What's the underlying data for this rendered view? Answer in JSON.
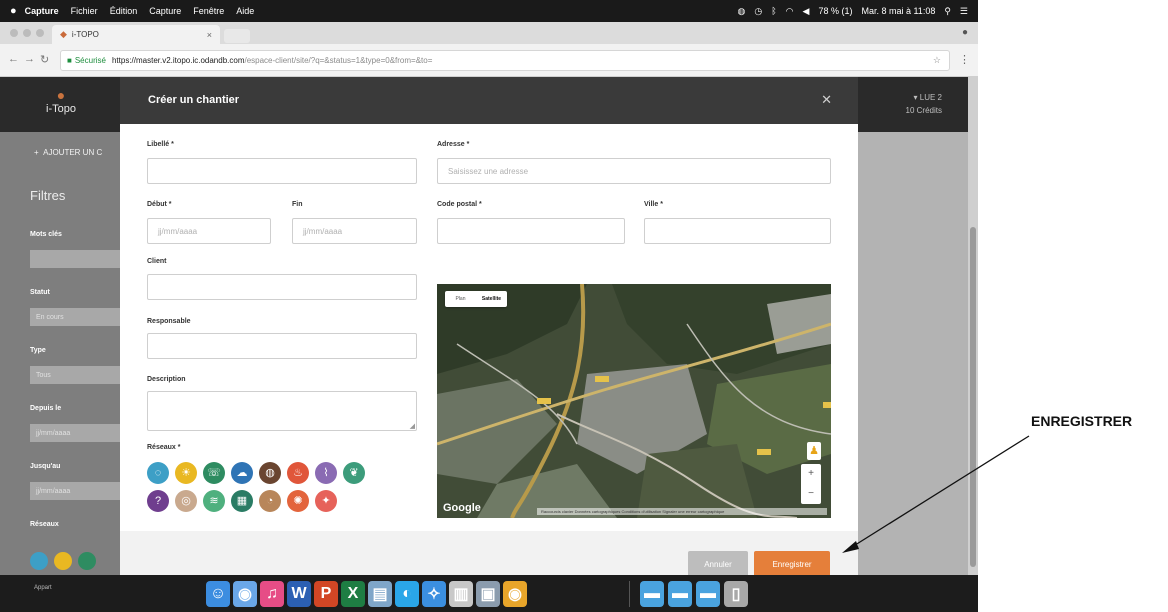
{
  "menubar": {
    "app": "Capture",
    "items": [
      "Fichier",
      "Édition",
      "Capture",
      "Fenêtre",
      "Aide"
    ],
    "battery": "78 % (1)",
    "datetime": "Mar. 8 mai à 11:08"
  },
  "browser": {
    "tab_title": "i-TOPO",
    "secure_label": "Sécurisé",
    "url_host": "https://master.v2.itopo.ic.odandb.com",
    "url_rest": "/espace-client/site/?q=&status=1&type=0&from=&to="
  },
  "app": {
    "logo_text": "i-Topo",
    "user_name": "LUE 2",
    "user_credits": "10 Crédits"
  },
  "sidebar": {
    "add_label": "AJOUTER UN C",
    "filters_title": "Filtres",
    "keywords_label": "Mots clés",
    "status_label": "Statut",
    "status_value": "En cours",
    "type_label": "Type",
    "type_value": "Tous",
    "since_label": "Depuis le",
    "since_placeholder": "jj/mm/aaaa",
    "until_label": "Jusqu'au",
    "until_placeholder": "jj/mm/aaaa",
    "networks_label": "Réseaux"
  },
  "modal": {
    "title": "Créer un chantier",
    "close_icon": "close-icon",
    "label_libelle": "Libellé *",
    "label_debut": "Début *",
    "label_fin": "Fin",
    "date_placeholder": "jj/mm/aaaa",
    "label_client": "Client",
    "label_responsable": "Responsable",
    "label_description": "Description",
    "label_reseaux": "Réseaux *",
    "label_adresse": "Adresse *",
    "adresse_placeholder": "Saisissez une adresse",
    "label_code_postal": "Code postal *",
    "label_ville": "Ville *",
    "map": {
      "toggle_plan": "Plan",
      "toggle_satellite": "Satellite",
      "google": "Google",
      "footer": "Raccourcis clavier  Données cartographiques  Conditions d'utilisation  Signaler une erreur cartographique"
    },
    "network_icons_row1": [
      {
        "icon": "water-drop-icon",
        "color": "#3d9fc6",
        "glyph": "◌"
      },
      {
        "icon": "light-bulb-icon",
        "color": "#e9b822",
        "glyph": "☀"
      },
      {
        "icon": "phone-icon",
        "color": "#2e8c61",
        "glyph": "☏"
      },
      {
        "icon": "cloud-icon",
        "color": "#2f74b5",
        "glyph": "☁"
      },
      {
        "icon": "gas-icon",
        "color": "#6a4530",
        "glyph": "◍"
      },
      {
        "icon": "flame-icon",
        "color": "#e0563a",
        "glyph": "♨"
      },
      {
        "icon": "signal-icon",
        "color": "#8a6bb3",
        "glyph": "⌇"
      },
      {
        "icon": "leaf-icon",
        "color": "#3c9c7b",
        "glyph": "❦"
      }
    ],
    "network_icons_row2": [
      {
        "icon": "question-icon",
        "color": "#6f3e8e",
        "glyph": "?"
      },
      {
        "icon": "ring-icon",
        "color": "#c9a98e",
        "glyph": "◎"
      },
      {
        "icon": "pipe-icon",
        "color": "#4fb07e",
        "glyph": "≋"
      },
      {
        "icon": "chart-icon",
        "color": "#2a7c64",
        "glyph": "▦"
      },
      {
        "icon": "gauge-icon",
        "color": "#b8865a",
        "glyph": "◔"
      },
      {
        "icon": "heat-icon",
        "color": "#e3643c",
        "glyph": "✺"
      },
      {
        "icon": "bulb-icon",
        "color": "#e6625a",
        "glyph": "✦"
      }
    ],
    "cancel_label": "Annuler",
    "save_label": "Enregistrer"
  },
  "dock": {
    "left_label": "Appart",
    "apps": [
      {
        "icon": "finder-icon",
        "color": "#3c8de0",
        "glyph": "☺"
      },
      {
        "icon": "chrome-icon",
        "color": "#6aa7e8",
        "glyph": "◉"
      },
      {
        "icon": "itunes-icon",
        "color": "#e64d86",
        "glyph": "♫"
      },
      {
        "icon": "word-icon",
        "color": "#2b5fb3",
        "glyph": "W"
      },
      {
        "icon": "powerpoint-icon",
        "color": "#d24625",
        "glyph": "P"
      },
      {
        "icon": "excel-icon",
        "color": "#1e7d43",
        "glyph": "X"
      },
      {
        "icon": "preview-icon",
        "color": "#7fa6c9",
        "glyph": "▤"
      },
      {
        "icon": "messages-icon",
        "color": "#2aa6e8",
        "glyph": "◐"
      },
      {
        "icon": "safari-icon",
        "color": "#3b8fe0",
        "glyph": "✧"
      },
      {
        "icon": "photos-icon",
        "color": "#c8c8c8",
        "glyph": "▥"
      },
      {
        "icon": "image-capture-icon",
        "color": "#8b9cae",
        "glyph": "▣"
      },
      {
        "icon": "chrome-alt-icon",
        "color": "#e8a52a",
        "glyph": "◉"
      },
      {
        "icon": "folder-icon",
        "color": "#4aa3df",
        "glyph": "▬"
      },
      {
        "icon": "downloads-folder-icon",
        "color": "#4aa3df",
        "glyph": "▬"
      },
      {
        "icon": "documents-folder-icon",
        "color": "#4aa3df",
        "glyph": "▬"
      },
      {
        "icon": "trash-icon",
        "color": "#a8a8a8",
        "glyph": "▯"
      }
    ]
  },
  "annotation": {
    "label": "ENREGISTRER"
  }
}
